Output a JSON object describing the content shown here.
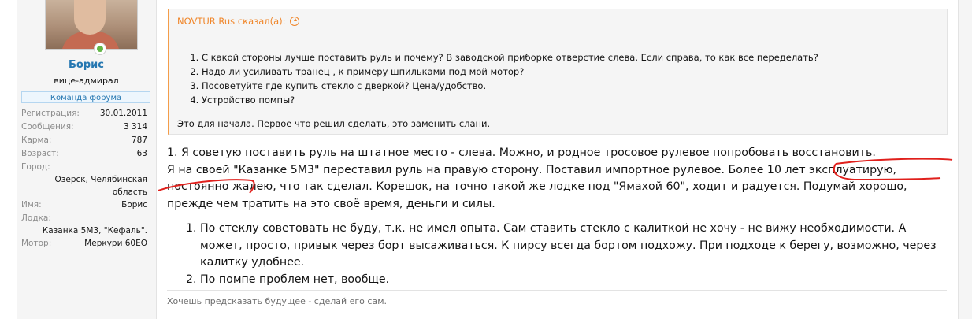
{
  "user": {
    "name": "Борис",
    "title": "вице-адмирал",
    "banner": "Команда форума",
    "stats": [
      {
        "label": "Регистрация:",
        "value": "30.01.2011"
      },
      {
        "label": "Сообщения:",
        "value": "3 314"
      },
      {
        "label": "Карма:",
        "value": "787"
      },
      {
        "label": "Возраст:",
        "value": "63"
      }
    ],
    "city_label": "Город:",
    "city_value": "Озерск, Челябинская область",
    "name_label": "Имя:",
    "name_value": "Борис",
    "boat_label": "Лодка:",
    "boat_value": "Казанка 5М3, \"Кефаль\".",
    "motor_label": "Мотор:",
    "motor_value": "Меркури 60ЕО"
  },
  "quote": {
    "header": "NOVTUR Rus сказал(а):",
    "items": [
      "С какой стороны лучше поставить руль и почему? В заводской приборке отверстие слева. Если справа, то как все переделать?",
      "Надо ли усиливать транец , к примеру шпильками под мой мотор?",
      "Посоветуйте где купить стекло с дверкой? Цена/удобство.",
      "Устройство помпы?"
    ],
    "footer": "Это для начала. Первое что решил сделать, это заменить слани."
  },
  "reply": {
    "p1": "1. Я советую поставить руль на штатное место - слева. Можно, и родное тросовое рулевое попробовать восстановить.",
    "p2": "Я на своей \"Казанке 5М3\" переставил руль на правую сторону. Поставил импортное рулевое. Более 10 лет эксплуатирую, постоянно жалею, что так сделал. Корешок, на точно такой же лодке под \"Ямахой 60\", ходит и радуется. Подумай хорошо, прежде чем тратить на это своё время, деньги и силы.",
    "items": [
      "По стеклу советовать не буду, т.к. не имел опыта. Сам ставить стекло с калиткой не хочу - не вижу необходимости. А может, просто, привык через борт высаживаться. К пирсу всегда бортом подхожу. При подходе к берегу, возможно, через калитку удобнее.",
      "По помпе проблем нет, вообще."
    ]
  },
  "signature": "Хочешь предсказать будущее - сделай его сам.",
  "colors": {
    "accent_orange": "#f0862a",
    "link_blue": "#2577b1",
    "annotation_red": "#e0201c",
    "online_green": "#63b646"
  }
}
